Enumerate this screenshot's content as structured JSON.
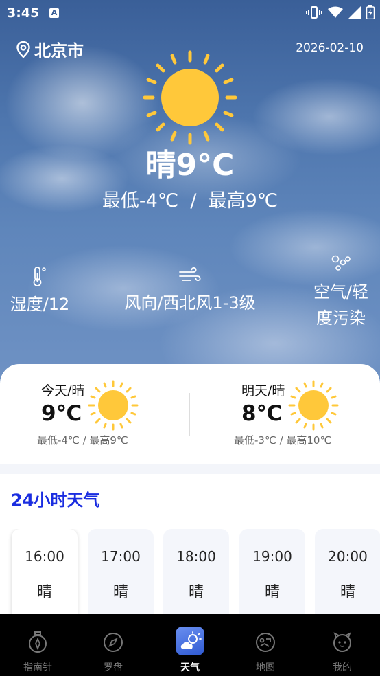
{
  "status_bar": {
    "time": "3:45",
    "a_badge": "A"
  },
  "location": {
    "city": "北京市"
  },
  "date": "2026-02-10",
  "current": {
    "condition_temp": "晴9°C",
    "range": "最低-4℃  /  最高9℃"
  },
  "stats": [
    {
      "label": "湿度/12",
      "icon": "thermometer-icon"
    },
    {
      "label": "风向/西北风1-3级",
      "icon": "wind-icon"
    },
    {
      "label_line1": "空气/轻",
      "label_line2": "度污染",
      "icon": "air-quality-icon"
    }
  ],
  "forecast": [
    {
      "label": "今天/晴",
      "temp": "9℃",
      "range": "最低-4℃ / 最高9℃"
    },
    {
      "label": "明天/晴",
      "temp": "8℃",
      "range": "最低-3℃ / 最高10℃"
    }
  ],
  "hourly": {
    "title": "24小时天气",
    "items": [
      {
        "time": "16:00",
        "cond": "晴"
      },
      {
        "time": "17:00",
        "cond": "晴"
      },
      {
        "time": "18:00",
        "cond": "晴"
      },
      {
        "time": "19:00",
        "cond": "晴"
      },
      {
        "time": "20:00",
        "cond": "晴"
      }
    ]
  },
  "nav": [
    {
      "label": "指南针",
      "icon": "compass-watch-icon"
    },
    {
      "label": "罗盘",
      "icon": "compass-icon"
    },
    {
      "label": "天气",
      "icon": "weather-icon",
      "active": true
    },
    {
      "label": "地图",
      "icon": "map-icon"
    },
    {
      "label": "我的",
      "icon": "profile-icon"
    }
  ],
  "colors": {
    "sun": "#ffc83a",
    "accent_title": "#1a2de0",
    "nav_bg": "#000000"
  }
}
